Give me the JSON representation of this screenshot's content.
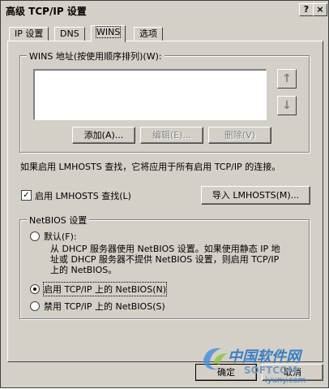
{
  "window": {
    "title": "高级 TCP/IP 设置",
    "help_glyph": "?",
    "close_glyph": "×"
  },
  "tabs": [
    {
      "label": "IP 设置"
    },
    {
      "label": "DNS"
    },
    {
      "label": "WINS"
    },
    {
      "label": "选项"
    }
  ],
  "wins": {
    "group_label": "WINS 地址(按使用顺序排列)(W):",
    "up_glyph": "↑",
    "down_glyph": "↓",
    "add_label": "添加(A)...",
    "edit_label": "编辑(E)...",
    "delete_label": "删除(V)"
  },
  "lmhosts": {
    "info": "如果启用 LMHOSTS 查找，它将应用于所有启用 TCP/IP 的连接。",
    "enable_label": "启用 LMHOSTS 查找(L)",
    "enable_checked": true,
    "check_glyph": "✓",
    "import_label": "导入 LMHOSTS(M)..."
  },
  "netbios": {
    "group_label": "NetBIOS 设置",
    "default_label": "默认(F):",
    "default_desc_1": "从 DHCP 服务器使用 NetBIOS 设置。如果使用静态 IP 地",
    "default_desc_2": "址或 DHCP 服务器不提供 NetBIOS 设置，则启用 TCP/IP",
    "default_desc_3": "上的 NetBIOS。",
    "enable_label": "启用 TCP/IP 上的 NetBIOS(N)",
    "disable_label": "禁用 TCP/IP 上的 NetBIOS(S)",
    "selected": "enable"
  },
  "footer": {
    "ok_label": "确定",
    "cancel_label": "取消"
  },
  "watermark": {
    "cn": "中国软件网",
    "en": "SOFTCOM",
    "url": "iyuny.com"
  }
}
